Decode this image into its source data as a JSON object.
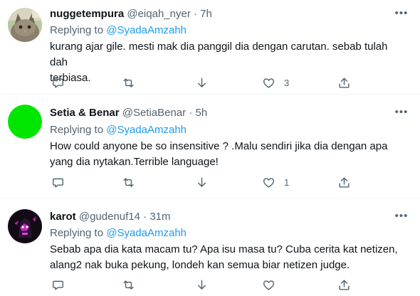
{
  "tweets": [
    {
      "name": "nuggetempura",
      "handle": "@eiqah_nyer",
      "dot": "·",
      "time": "7h",
      "replying_label": "Replying to",
      "mention": "@SyadaAmzahh",
      "text_lines": [
        "kurang ajar gile. mesti mak dia panggil dia dengan carutan. sebab tulah dah",
        "terbiasa."
      ],
      "like_count": "3",
      "avatar": "cat-photo"
    },
    {
      "name": "Setia & Benar",
      "handle": "@SetiaBenar",
      "dot": "·",
      "time": "5h",
      "replying_label": "Replying to",
      "mention": "@SyadaAmzahh",
      "text_lines": [
        "How could anyone be so insensitive ? .Malu sendiri jika dia dengan apa",
        "yang dia nytakan.Terrible language!"
      ],
      "like_count": "1",
      "avatar": "green-circle",
      "avatar_color": "#00e600"
    },
    {
      "name": "karot",
      "handle": "@gudenuf14",
      "dot": "·",
      "time": "31m",
      "replying_label": "Replying to",
      "mention": "@SyadaAmzahh",
      "text_lines": [
        "Sebab apa dia kata macam tu? Apa isu masa tu? Cuba cerita kat netizen,",
        "alang2 nak buka pekung, londeh kan semua biar netizen judge."
      ],
      "like_count": "",
      "avatar": "dark-character"
    }
  ],
  "more_icon": "more-horizontal-icon",
  "colors": {
    "text": "#0f1419",
    "secondary": "#536471",
    "accent": "#1d9bf0",
    "divider": "#eff3f4"
  }
}
